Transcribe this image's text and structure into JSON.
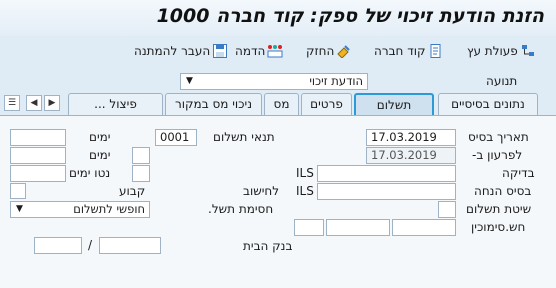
{
  "title": "הזנת הודעת זיכוי של ספק: קוד חברה 1000",
  "toolbar": {
    "hold_label": "פעולת עץ",
    "company_code_label": "קוד חברה",
    "park_label": "החזק",
    "simulate_label": "הדמה",
    "save_as_completed_label": "העבר להמתנה"
  },
  "transaction": {
    "label": "תנועה",
    "value": "הודעת זיכוי"
  },
  "tabs": [
    {
      "label": "נתונים בסיסיים"
    },
    {
      "label": "תשלום",
      "active": true
    },
    {
      "label": "פרטים"
    },
    {
      "label": "מס"
    },
    {
      "label": "ניכוי מס במקור"
    },
    {
      "label": "פיצול ..."
    }
  ],
  "payment": {
    "baseline_date_label": "תאריך בסיס",
    "baseline_date": "17.03.2019",
    "due_on_label": "לפרעון ב-",
    "due_on": "17.03.2019",
    "cash_discount_label": "בדיקה",
    "cash_discount_currency": "ILS",
    "discount_base_label": "בסיס הנחה",
    "discount_base_currency": "ILS",
    "payment_method_label": "שיטת תשלום",
    "account_label": "חש.סימוכין",
    "house_bank_label": "בנק הבית",
    "house_bank_sep": "/",
    "payment_terms_label": "תנאי תשלום",
    "payment_terms_value": "0001",
    "calc_label": "לחישוב",
    "payment_block_label": "חסימת תשל.",
    "payment_block_value": "חופשי לתשלום",
    "days1_label": "ימים",
    "days2_label": "ימים",
    "net_days_label": "נטו ימים",
    "fixed_label": "קבוע"
  }
}
